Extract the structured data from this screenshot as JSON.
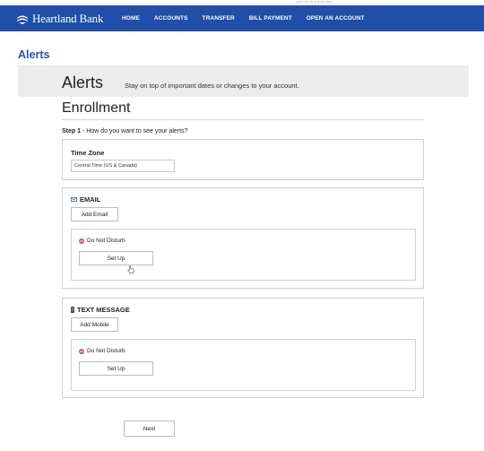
{
  "top_note": "LAST LOG IN: JUN 26, 2020",
  "brand": {
    "name": "Heartland Bank",
    "color": "#1f4fa8",
    "logo_icon": "heartland-logo-icon"
  },
  "nav": [
    {
      "label": "HOME"
    },
    {
      "label": "ACCOUNTS"
    },
    {
      "label": "TRANSFER"
    },
    {
      "label": "BILL PAYMENT"
    },
    {
      "label": "OPEN AN ACCOUNT"
    }
  ],
  "page_title": "Alerts",
  "banner": {
    "title": "Alerts",
    "subtitle": "Stay on top of important dates or changes to your account."
  },
  "enrollment": {
    "title": "Enrollment",
    "step_label": "Step 1",
    "step_text": " - How do you want to see your alerts?"
  },
  "time_zone": {
    "label": "Time Zone",
    "value": "Central Time (US & Canada)"
  },
  "email_section": {
    "heading": "EMAIL",
    "icon": "envelope-icon",
    "add_button": "Add Email",
    "dnd_label": "Do Not Disturb",
    "dnd_icon": "do-not-disturb-icon",
    "setup_button": "Set Up"
  },
  "sms_section": {
    "heading": "TEXT MESSAGE",
    "icon": "mobile-phone-icon",
    "add_button": "Add Mobile",
    "dnd_label": "Do Not Disturb",
    "dnd_icon": "do-not-disturb-icon",
    "setup_button": "Set Up"
  },
  "next_button": "Next",
  "colors": {
    "accent": "#2b55a8",
    "dnd_red": "#d9534f"
  }
}
